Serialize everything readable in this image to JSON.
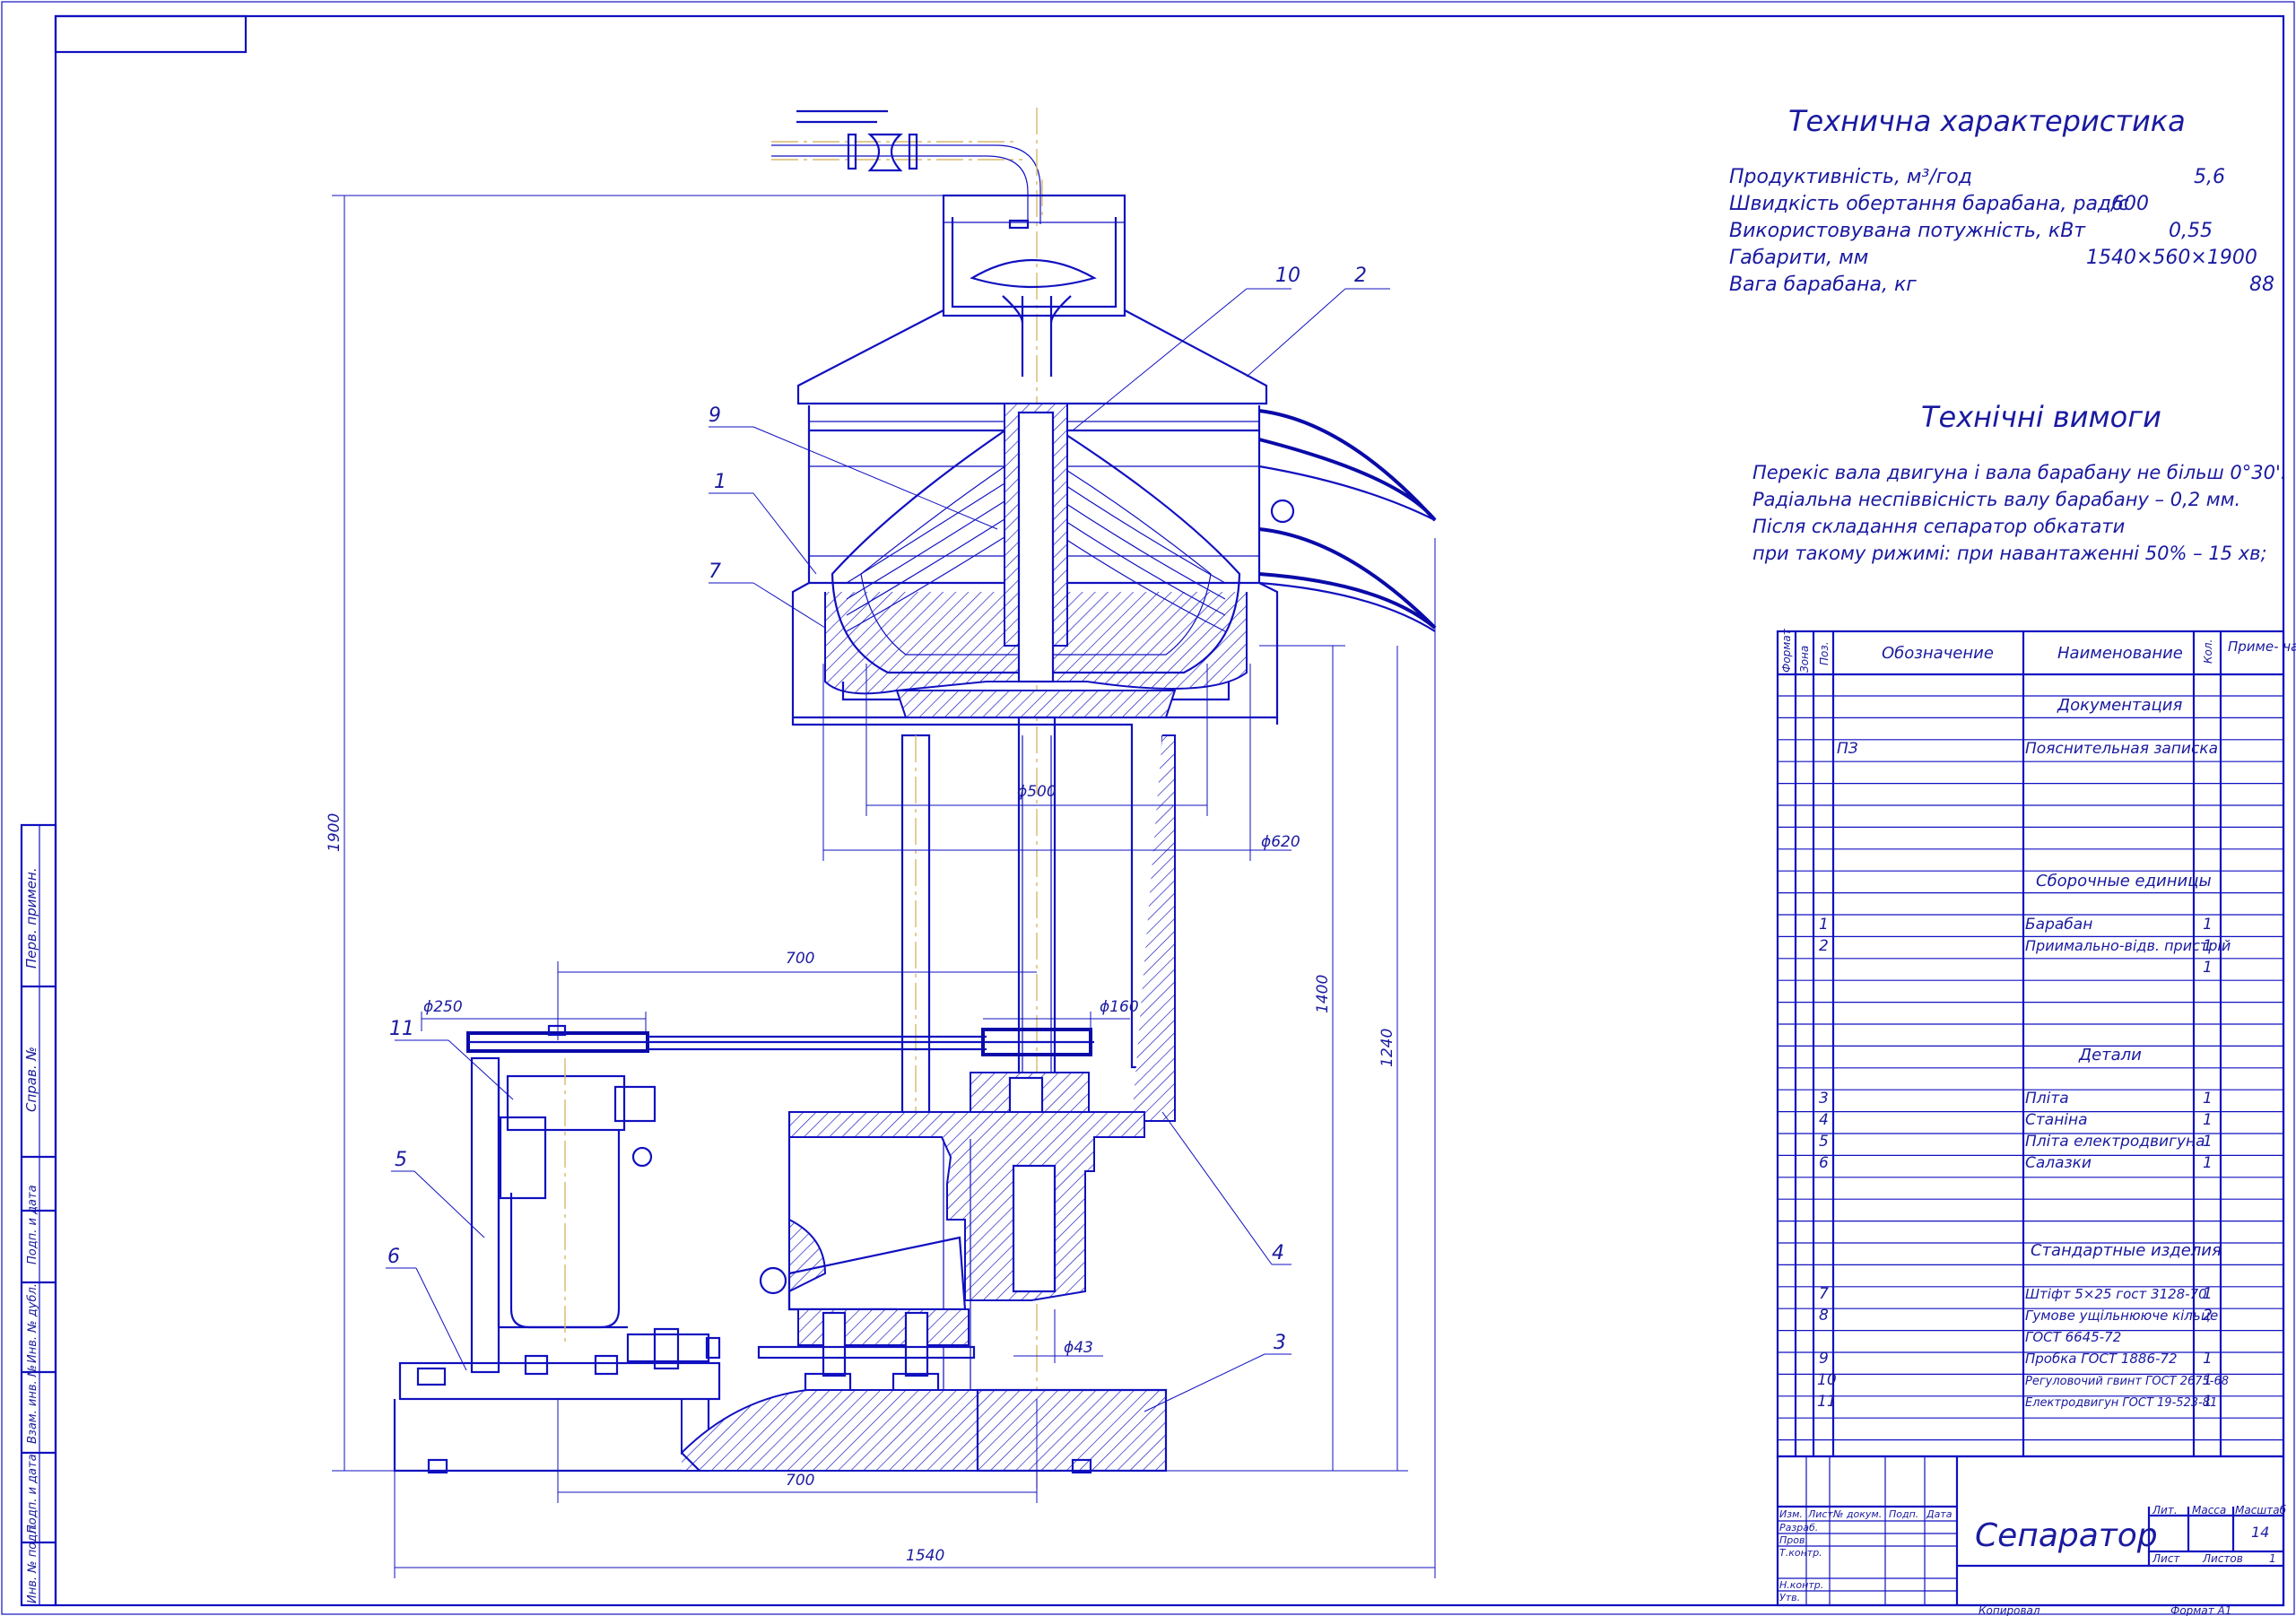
{
  "title_block": {
    "name": "Сепаратор",
    "sheet_no": "14",
    "headers": [
      "Лит.",
      "Масса",
      "Масштаб"
    ],
    "row_labels": [
      "Лист",
      "Листов",
      "1"
    ],
    "col_labels": [
      "Изм.",
      "Лист",
      "№ докум.",
      "Подп.",
      "Дата"
    ],
    "roles": [
      "Разраб.",
      "Пров.",
      "Т.контр.",
      "Н.контр.",
      "Утв."
    ],
    "copied": "Копировал",
    "format": "Формат   А1"
  },
  "side_stamps": [
    "Перв. примен.",
    "Справ. №",
    "Подп. и дата",
    "Инв. № дубл.",
    "Взам. инв. №",
    "Подп. и дата",
    "Инв. № подл."
  ],
  "tech_char": {
    "title": "Технична характеристика",
    "rows": [
      {
        "label": "Продуктивність, м³/год",
        "value": "5,6"
      },
      {
        "label": "Швидкість обертання барабана, рад/с",
        "value": "600"
      },
      {
        "label": "Використовувана потужність, кВт",
        "value": "0,55"
      },
      {
        "label": "Габарити, мм",
        "value": "1540×560×1900"
      },
      {
        "label": "Вага барабана, кг",
        "value": "88"
      }
    ]
  },
  "tech_req": {
    "title": "Технічні вимоги",
    "lines": [
      "Перекіс вала двигуна і вала барабану не більш 0°30'.",
      "Радіальна неспіввісність  валу барабану – 0,2 мм.",
      "Після складання сепаратор обкатати",
      "  при такому рижимі: при навантаженні 50% – 15 хв;"
    ]
  },
  "spec": {
    "headers": {
      "format": "Формат",
      "zone": "Зона",
      "pos": "Поз.",
      "designation": "Обозначение",
      "name": "Наименование",
      "qty": "Кол.",
      "note": "Приме- чание"
    },
    "sections": [
      {
        "title": "Документация",
        "items": [
          {
            "pos": "",
            "designation": "ПЗ",
            "name": "Пояснительная записка",
            "qty": ""
          }
        ]
      },
      {
        "title": "Сборочные единицы",
        "items": [
          {
            "pos": "1",
            "designation": "",
            "name": "Барабан",
            "qty": "1"
          },
          {
            "pos": "2",
            "designation": "",
            "name": "Приимально-відв. пристрій",
            "qty": "1"
          },
          {
            "pos": "",
            "designation": "",
            "name": "",
            "qty": "1"
          }
        ]
      },
      {
        "title": "Детали",
        "items": [
          {
            "pos": "3",
            "designation": "",
            "name": "Пліта",
            "qty": "1"
          },
          {
            "pos": "4",
            "designation": "",
            "name": "Станіна",
            "qty": "1"
          },
          {
            "pos": "5",
            "designation": "",
            "name": "Пліта електродвигуна",
            "qty": "1"
          },
          {
            "pos": "6",
            "designation": "",
            "name": "Салазки",
            "qty": "1"
          }
        ]
      },
      {
        "title": "Стандартные изделия",
        "items": [
          {
            "pos": "7",
            "designation": "",
            "name": "Штіфт 5×25 гост 3128-70",
            "qty": "1"
          },
          {
            "pos": "8",
            "designation": "",
            "name": "Гумове ущільнююче кільце",
            "qty": "2"
          },
          {
            "pos": "",
            "designation": "",
            "name": "ГОСТ 6645-72",
            "qty": ""
          },
          {
            "pos": "9",
            "designation": "",
            "name": "Пробка ГОСТ 1886-72",
            "qty": "1"
          },
          {
            "pos": "10",
            "designation": "",
            "name": "Регуловочий гвинт ГОСТ 2675-68",
            "qty": "1"
          },
          {
            "pos": "11",
            "designation": "",
            "name": "Електродвигун ГОСТ 19-523-81",
            "qty": "1"
          }
        ]
      }
    ]
  },
  "dimensions": {
    "d500": "ϕ500",
    "d620": "ϕ620",
    "d250": "ϕ250",
    "d160": "ϕ160",
    "d43": "ϕ43",
    "h1900": "1900",
    "h1400": "1400",
    "h1240": "1240",
    "w700_top": "700",
    "w700_bottom": "700",
    "w1540": "1540"
  },
  "callouts": [
    "10",
    "2",
    "9",
    "1",
    "7",
    "11",
    "5",
    "6",
    "4",
    "3"
  ],
  "colors": {
    "line": "#1010c0",
    "axis": "#d9b96a",
    "paper": "#ffffff"
  }
}
